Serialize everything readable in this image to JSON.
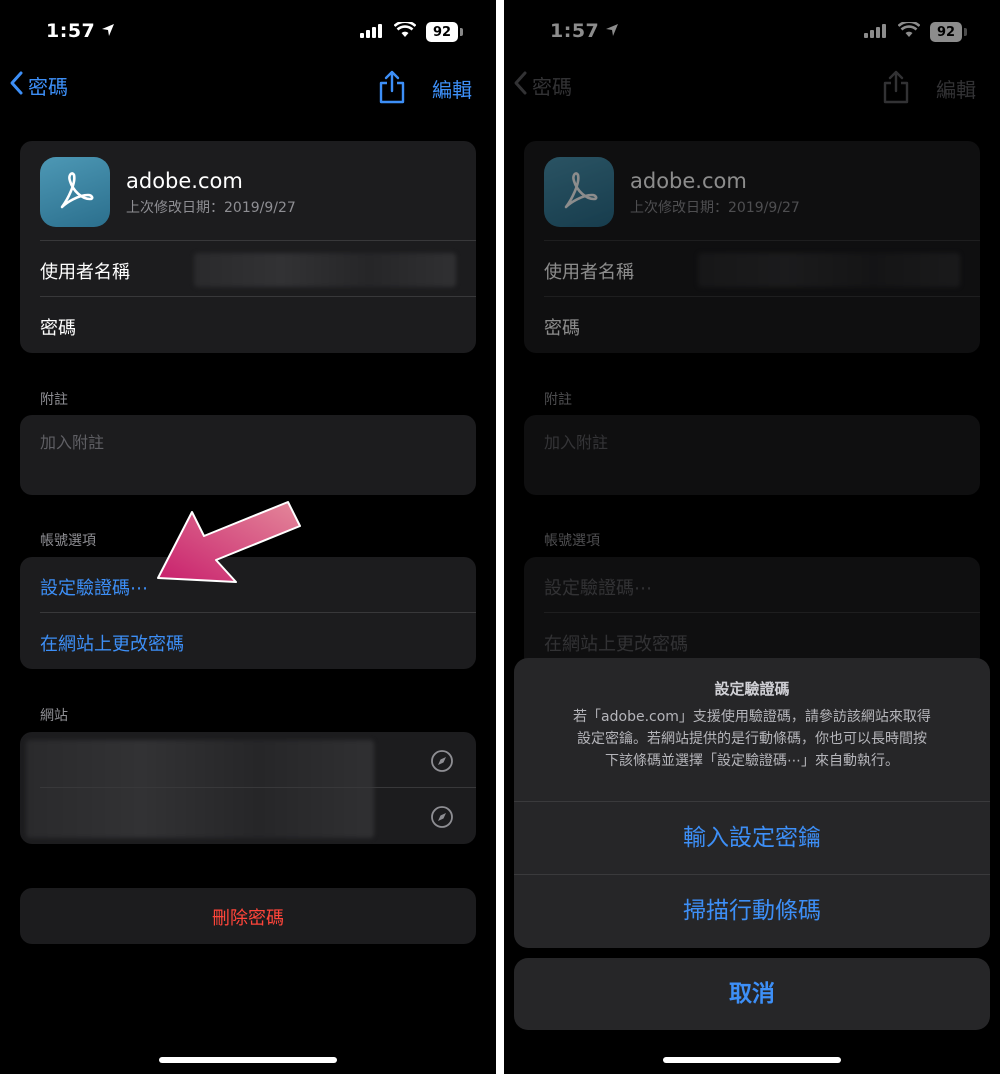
{
  "status": {
    "time": "1:57",
    "battery": "92"
  },
  "nav": {
    "back_label": "密碼",
    "edit_label": "編輯"
  },
  "site": {
    "name": "adobe.com",
    "modified": "上次修改日期：2019/9/27"
  },
  "fields": {
    "username_label": "使用者名稱",
    "password_label": "密碼"
  },
  "notes": {
    "section_label": "附註",
    "placeholder": "加入附註"
  },
  "account_options": {
    "section_label": "帳號選項",
    "setup_code": "設定驗證碼⋯",
    "change_password": "在網站上更改密碼"
  },
  "websites": {
    "section_label": "網站"
  },
  "delete_label": "刪除密碼",
  "action_sheet": {
    "title": "設定驗證碼",
    "message_lines": [
      "若「adobe.com」支援使用驗證碼，請參訪該網站來取得",
      "設定密鑰。若網站提供的是行動條碼，你也可以長時間按",
      "下該條碼並選擇「設定驗證碼⋯」來自動執行。"
    ],
    "enter_key": "輸入設定密鑰",
    "scan_qr": "掃描行動條碼",
    "cancel": "取消"
  },
  "colors": {
    "accent": "#3d8ff7",
    "destructive": "#ff453a",
    "annotation_arrow": "#d8337a"
  }
}
